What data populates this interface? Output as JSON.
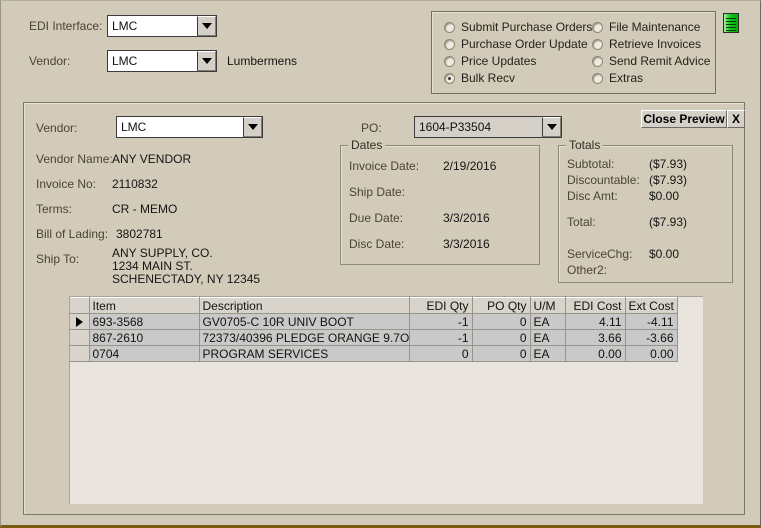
{
  "top_form": {
    "edi_interface_label": "EDI Interface:",
    "edi_interface_value": "LMC",
    "vendor_label": "Vendor:",
    "vendor_value": "LMC",
    "vendor_name_text": "Lumbermens"
  },
  "mode_panel": {
    "options": [
      {
        "label": "Submit Purchase Orders",
        "selected": false
      },
      {
        "label": "Purchase Order Update",
        "selected": false
      },
      {
        "label": "Price Updates",
        "selected": false
      },
      {
        "label": "Bulk Recv",
        "selected": true
      },
      {
        "label": "File Maintenance",
        "selected": false
      },
      {
        "label": "Retrieve Invoices",
        "selected": false
      },
      {
        "label": "Send Remit Advice",
        "selected": false
      },
      {
        "label": "Extras",
        "selected": false
      }
    ],
    "icon": "green-list-icon"
  },
  "preview": {
    "vendor_label": "Vendor:",
    "vendor_value": "LMC",
    "po_label": "PO:",
    "po_value": "1604-P33504",
    "close_preview_label": "Close Preview",
    "close_label": "X",
    "fields": [
      {
        "label": "Vendor Name:",
        "value": "ANY VENDOR"
      },
      {
        "label": "Invoice No:",
        "value": "2110832"
      },
      {
        "label": "Terms:",
        "value": "CR - MEMO"
      },
      {
        "label": "Bill of Lading:",
        "value": "3802781"
      }
    ],
    "ship_to_label": "Ship To:",
    "ship_to_lines": [
      "ANY SUPPLY, CO.",
      "1234 MAIN ST.",
      "SCHENECTADY, NY 12345"
    ],
    "dates": {
      "title": "Dates",
      "rows": [
        {
          "label": "Invoice Date:",
          "value": "2/19/2016"
        },
        {
          "label": "Ship Date:",
          "value": ""
        },
        {
          "label": "Due Date:",
          "value": "3/3/2016"
        },
        {
          "label": "Disc Date:",
          "value": "3/3/2016"
        }
      ]
    },
    "totals": {
      "title": "Totals",
      "rows": [
        {
          "label": "Subtotal:",
          "value": "($7.93)"
        },
        {
          "label": "Discountable:",
          "value": "($7.93)"
        },
        {
          "label": "Disc Amt:",
          "value": "$0.00"
        },
        {
          "label": "Total:",
          "value": "($7.93)"
        },
        {
          "label": "ServiceChg:",
          "value": "$0.00"
        },
        {
          "label": "Other2:",
          "value": ""
        }
      ]
    },
    "grid": {
      "columns": [
        "Item",
        "Description",
        "EDI Qty",
        "PO Qty",
        "U/M",
        "EDI Cost",
        "Ext Cost"
      ],
      "rows": [
        {
          "selected": true,
          "item": "693-3568",
          "description": "GV0705-C 10R UNIV BOOT",
          "edi_qty": "-1",
          "po_qty": "0",
          "um": "EA",
          "edi_cost": "4.11",
          "ext_cost": "-4.11"
        },
        {
          "selected": false,
          "item": "867-2610",
          "description": "72373/40396 PLEDGE ORANGE 9.7O",
          "edi_qty": "-1",
          "po_qty": "0",
          "um": "EA",
          "edi_cost": "3.66",
          "ext_cost": "-3.66"
        },
        {
          "selected": false,
          "item": "0704",
          "description": "PROGRAM SERVICES",
          "edi_qty": "0",
          "po_qty": "0",
          "um": "EA",
          "edi_cost": "0.00",
          "ext_cost": "0.00"
        }
      ]
    }
  },
  "colors": {
    "window_bg": "#d3cbb9",
    "grid_row_bg": "#c9c9c9",
    "grid_header_bg": "#d8d4cb",
    "bottom_border": "#7a5c10",
    "icon_green": "#16c41a"
  }
}
